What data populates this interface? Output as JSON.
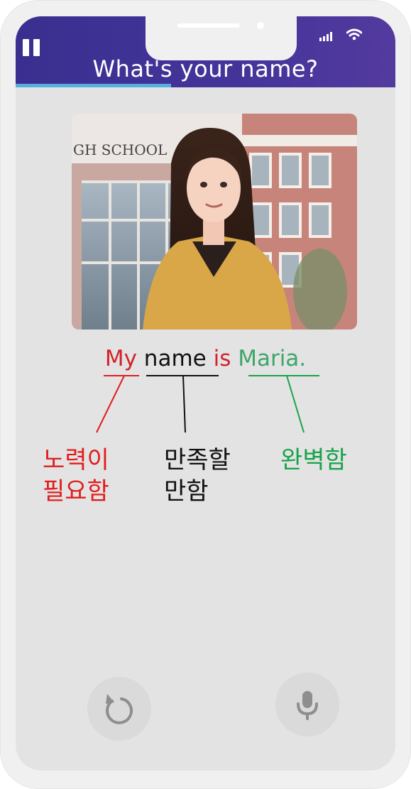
{
  "header": {
    "title": "What's your name?",
    "progress_fraction": 0.41
  },
  "icons": {
    "pause": "pause-icon",
    "signal": "signal-bars-icon",
    "wifi": "wifi-icon",
    "retry": "retry-icon",
    "microphone": "microphone-icon"
  },
  "photo": {
    "sign_text": "GH SCHOOL"
  },
  "sentence": {
    "words": [
      {
        "text": "My",
        "grade": "needs-work",
        "color": "#d1232a"
      },
      {
        "text": "name",
        "grade": "satisfactory",
        "color": "#111111"
      },
      {
        "text": "is",
        "grade": "needs-work",
        "color": "#d1232a"
      },
      {
        "text": "Maria.",
        "grade": "perfect",
        "color": "#3ea66a"
      }
    ]
  },
  "feedback": {
    "needs_work": {
      "line1": "노력이",
      "line2": "필요함",
      "color": "#e01e1e"
    },
    "satisfactory": {
      "line1": "만족할",
      "line2": "만함",
      "color": "#111111"
    },
    "perfect": {
      "line1": "완벽함",
      "color": "#18a34a"
    }
  },
  "colors": {
    "header_start": "#3a2f8f",
    "header_end": "#533a9e",
    "progress": "#58aede",
    "screen_bg": "#e3e3e3"
  }
}
